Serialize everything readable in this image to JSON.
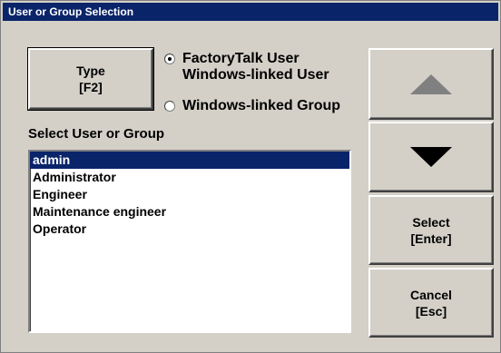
{
  "window": {
    "title": "User or Group Selection"
  },
  "type_button": {
    "line1": "Type",
    "line2": "[F2]"
  },
  "user_type_options": [
    {
      "label_line1": "FactoryTalk User",
      "label_line2": "Windows-linked User",
      "checked": true
    },
    {
      "label_line1": "Windows-linked Group",
      "label_line2": "",
      "checked": false
    }
  ],
  "list": {
    "label": "Select User or Group",
    "items": [
      "admin",
      "Administrator",
      "Engineer",
      "Maintenance engineer",
      "Operator"
    ],
    "selected": "admin"
  },
  "buttons": {
    "scroll_up_icon": "arrow-up-icon",
    "scroll_down_icon": "arrow-down-icon",
    "select_line1": "Select",
    "select_line2": "[Enter]",
    "cancel_line1": "Cancel",
    "cancel_line2": "[Esc]"
  },
  "colors": {
    "titlebar": "#0a246a",
    "selection": "#0a246a",
    "face": "#d4d0c8",
    "disabled_arrow": "#808080"
  }
}
